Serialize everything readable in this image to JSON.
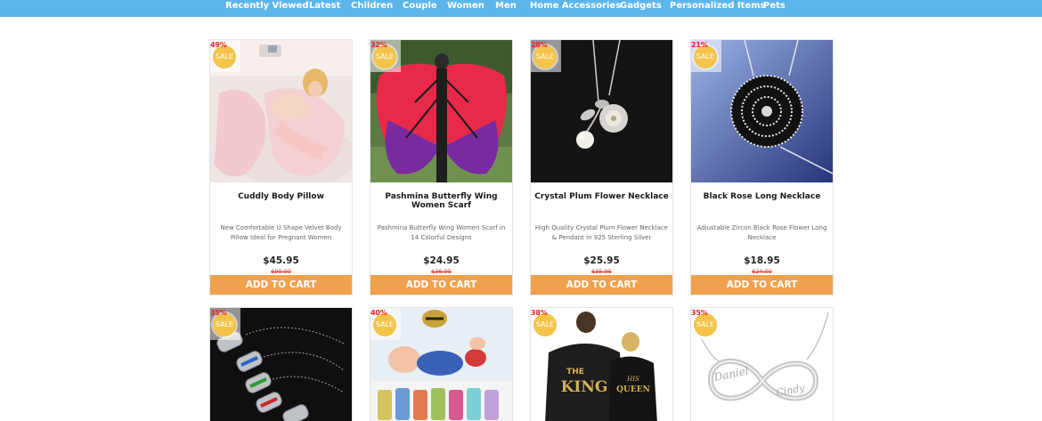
{
  "nav": {
    "items": [
      "Recently Viewed",
      "Latest",
      "Children",
      "Couple",
      "Women",
      "Men",
      "Home Accessories",
      "Gadgets",
      "Personalized Items",
      "Pets"
    ]
  },
  "sale_label": "SALE",
  "cart_label": "ADD TO CART",
  "colors": {
    "nav": "#5db6ea",
    "cart_button": "#f0a14e",
    "discount": "#e8262d",
    "sale_badge": "#f3c34a"
  },
  "products": [
    {
      "discount": "49%",
      "title": "Cuddly Body Pillow",
      "description": "New Comfortable U Shape Velvet Body Pillow Ideal for Pregnant Women",
      "price": "$45.95",
      "old_price": "$90.00"
    },
    {
      "discount": "32%",
      "title": "Pashmina Butterfly Wing Women Scarf",
      "description": "Pashmina Butterfly Wing Women Scarf in 14 Colorful Designs",
      "price": "$24.95",
      "old_price": "$36.95"
    },
    {
      "discount": "28%",
      "title": "Crystal Plum Flower Necklace",
      "description": "High Quality Crystal Plum Flower Necklace & Pendant in 925 Sterling Silver",
      "price": "$25.95",
      "old_price": "$35.95"
    },
    {
      "discount": "21%",
      "title": "Black Rose Long Necklace",
      "description": "Adjustable Zircon Black Rose Flower Long Necklace",
      "price": "$18.95",
      "old_price": "$24.00"
    },
    {
      "discount": "35%"
    },
    {
      "discount": "40%"
    },
    {
      "discount": "38%",
      "image_text": {
        "word1": "THE",
        "word2": "KING",
        "word3": "HIS",
        "word4": "QUEEN"
      }
    },
    {
      "discount": "35%",
      "image_text": {
        "name1": "Daniel",
        "name2": "Cindy"
      }
    }
  ]
}
